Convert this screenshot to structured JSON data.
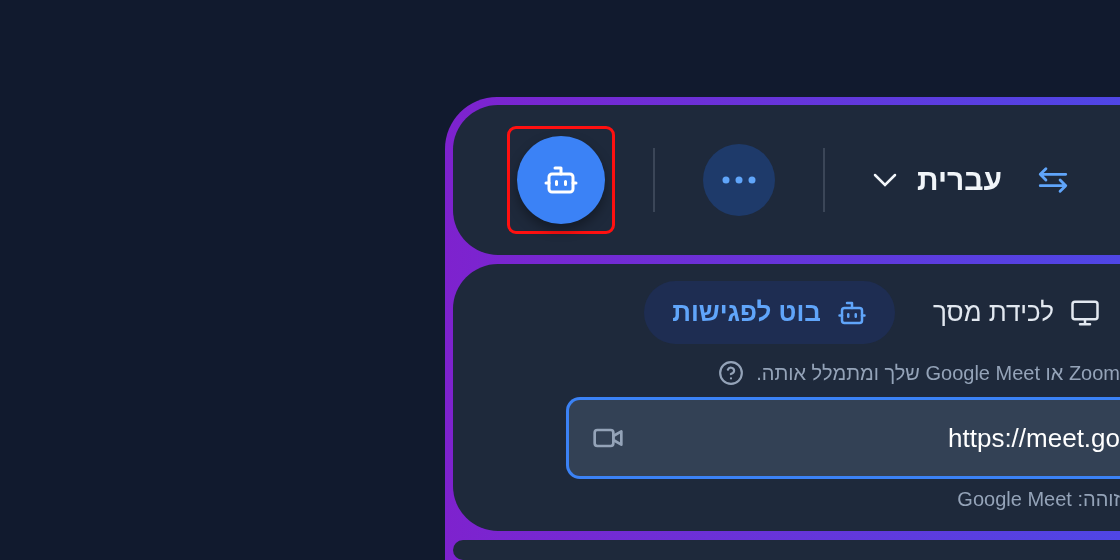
{
  "toolbar": {
    "robot_button": {
      "selected": true,
      "highlighted": true
    },
    "language": "עברית"
  },
  "modes": [
    {
      "label": "לכידת מסך",
      "kind": "screen",
      "selected": false
    },
    {
      "label": "בוט לפגישות",
      "kind": "bot",
      "selected": true
    }
  ],
  "help_text": "Zoom או Google Meet שלך ומתמלל אותה.",
  "meeting_url": {
    "value": "https://meet.go"
  },
  "detected": "זוהה: Google Meet"
}
